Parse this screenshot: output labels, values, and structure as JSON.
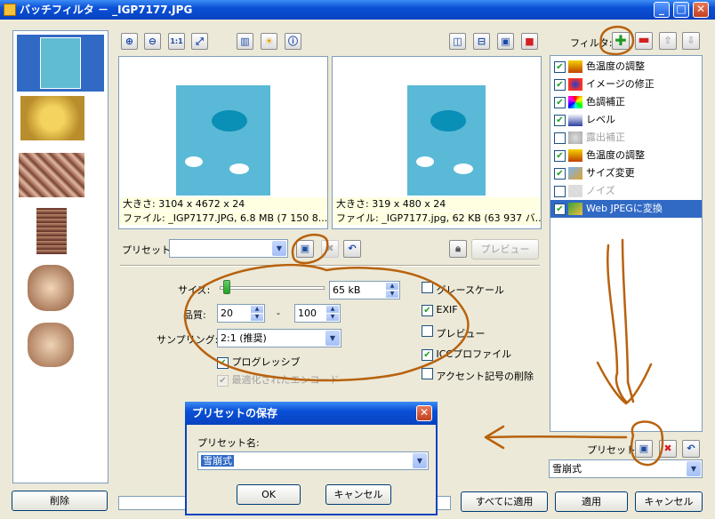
{
  "window": {
    "title": "バッチフィルタ － _IGP7177.JPG",
    "min": "_",
    "max": "□",
    "close": "✕"
  },
  "left": {
    "delete_label": "削除"
  },
  "toolbar_icons": [
    "zoom-in-icon",
    "zoom-out-icon",
    "actual-size-icon",
    "fit-icon",
    "histogram-icon",
    "sun-icon",
    "info-icon"
  ],
  "view_icons": [
    "split-vertical-icon",
    "split-horizontal-icon",
    "single-view-icon",
    "preview-icon"
  ],
  "filter_header": {
    "label": "フィルタ:"
  },
  "images": {
    "original": {
      "size_line": "大きさ: 3104 x 4672 x 24",
      "file_line": "ファイル: _IGP7177.JPG, 6.8 MB (7 150 8..."
    },
    "result": {
      "size_line": "大きさ: 319 x 480 x 24",
      "file_line": "ファイル: _IGP7177.jpg, 62 KB (63 937 バ..."
    }
  },
  "preset_row": {
    "label": "プリセット:",
    "value": "",
    "preview_label": "プレビュー"
  },
  "settings": {
    "size_label": "サイズ:",
    "size_value": "65 kB",
    "quality_label": "品質:",
    "quality_min": "20",
    "quality_dash": "-",
    "quality_max": "100",
    "sampling_label": "サンプリング:",
    "sampling_value": "2:1 (推奨)",
    "progressive_label": "プログレッシブ",
    "optimized_label": "最適化されたエンコード",
    "grayscale_label": "グレースケール",
    "exif_label": "EXIF",
    "preview_label": "プレビュー",
    "icc_label": "ICCプロファイル",
    "accent_label": "アクセント記号の削除"
  },
  "filters": [
    {
      "label": "色温度の調整",
      "checked": true,
      "icon": "temperature-icon"
    },
    {
      "label": "イメージの修正",
      "checked": true,
      "icon": "image-fix-icon"
    },
    {
      "label": "色調補正",
      "checked": true,
      "icon": "color-balance-icon"
    },
    {
      "label": "レベル",
      "checked": true,
      "icon": "levels-icon"
    },
    {
      "label": "露出補正",
      "checked": false,
      "icon": "exposure-icon"
    },
    {
      "label": "色温度の調整",
      "checked": true,
      "icon": "temperature-icon"
    },
    {
      "label": "サイズ変更",
      "checked": true,
      "icon": "resize-icon"
    },
    {
      "label": "ノイズ",
      "checked": false,
      "icon": "noise-icon"
    },
    {
      "label": "Web JPEGに変換",
      "checked": true,
      "icon": "web-jpeg-icon"
    }
  ],
  "right_preset": {
    "label": "プリセット:",
    "value": "雪崩式"
  },
  "bottom": {
    "apply_all": "すべてに適用",
    "apply": "適用",
    "cancel": "キャンセル"
  },
  "dialog": {
    "title": "プリセットの保存",
    "name_label": "プリセット名:",
    "name_value": "雪崩式",
    "ok": "OK",
    "cancel": "キャンセル"
  },
  "colors": {
    "titlebar": "#0a50d6",
    "selection": "#316ac5",
    "annotation": "#b8620e"
  }
}
